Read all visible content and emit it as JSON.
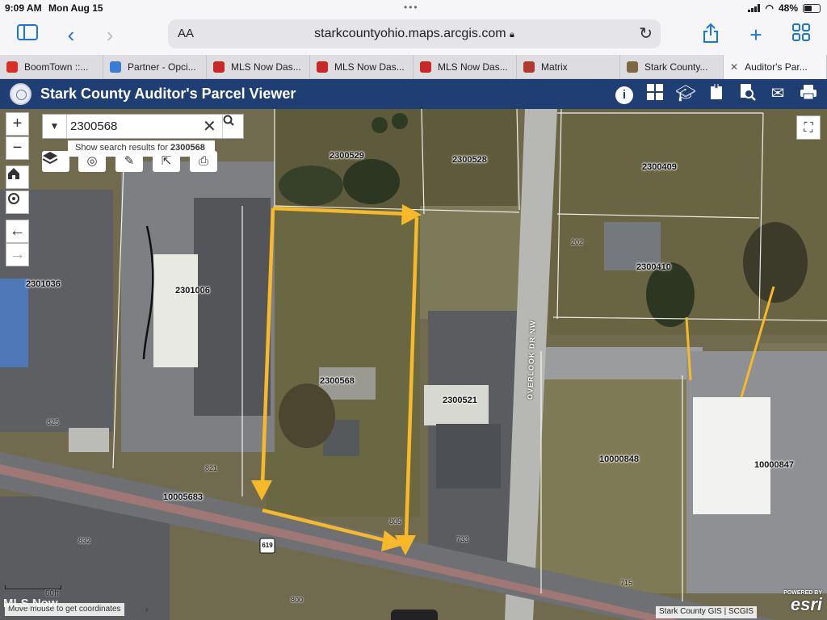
{
  "status_bar": {
    "time": "9:09 AM",
    "date": "Mon Aug 15",
    "battery": "48%"
  },
  "browser": {
    "aa_label": "AA",
    "url": "starkcountyohio.maps.arcgis.com",
    "tabs": [
      {
        "label": "BoomTown ::...",
        "color": "#d93025"
      },
      {
        "label": "Partner - Opci...",
        "color": "#3a7bd5"
      },
      {
        "label": "MLS Now Das...",
        "color": "#c62828"
      },
      {
        "label": "MLS Now Das...",
        "color": "#c62828"
      },
      {
        "label": "MLS Now Das...",
        "color": "#c62828"
      },
      {
        "label": "Matrix",
        "color": "#b03a2e"
      },
      {
        "label": "Stark County...",
        "color": "#7a6a40"
      },
      {
        "label": "Auditor's Par...",
        "color": "#888888"
      }
    ]
  },
  "header": {
    "title": "Stark County Auditor's Parcel Viewer",
    "bg": "#1f3e73"
  },
  "search": {
    "value": "2300568",
    "suggest_prefix": "Show search results for",
    "suggest_value": "2300568"
  },
  "parcels": {
    "p1": "2300529",
    "p2": "2300528",
    "p3": "2300409",
    "p4": "2300410",
    "p5": "2301036",
    "p6": "2301006",
    "p7": "2300568",
    "p8": "2300521",
    "p9": "10000848",
    "p10": "10000847",
    "p11": "10005683"
  },
  "addresses": {
    "a1": "202",
    "a2": "825",
    "a3": "821",
    "a4": "805",
    "a5": "733",
    "a6": "832",
    "a7": "800",
    "a8": "715"
  },
  "road_label": "OVERLOOK DR NW",
  "route_shield": "619",
  "map_footer": {
    "scale": "60ft",
    "coords": "Move mouse to get coordinates",
    "attribution": "Stark County GIS | SCGIS",
    "esri_prefix": "POWERED BY",
    "esri_logo": "esri",
    "watermark": "MLS Now"
  },
  "colors": {
    "annotation": "#f7b928",
    "parcel_line": "#ffffff"
  }
}
